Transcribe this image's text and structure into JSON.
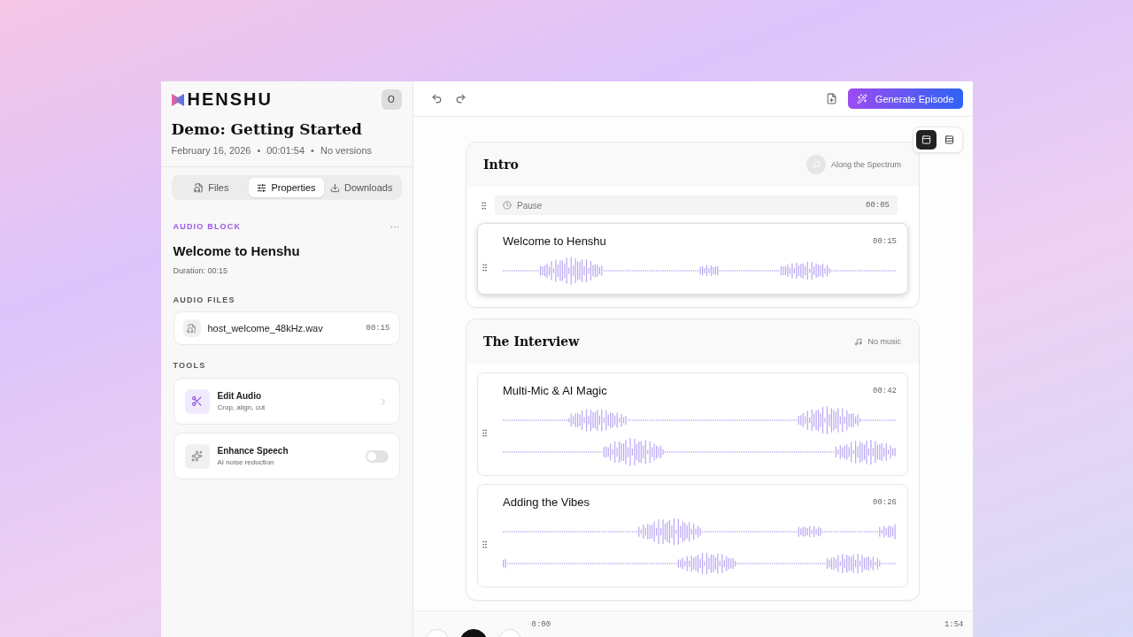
{
  "brand": {
    "name": "HENSHU",
    "avatar": "O"
  },
  "project": {
    "title": "Demo: Getting Started",
    "meta": [
      "February 16, 2026",
      "•",
      "00:01:54",
      "•",
      "No versions"
    ]
  },
  "tabs": [
    {
      "label": "Files",
      "selected": false
    },
    {
      "label": "Properties",
      "selected": true
    },
    {
      "label": "Downloads",
      "selected": false
    }
  ],
  "block": {
    "kicker": "AUDIO BLOCK",
    "menu": "···",
    "title": "Welcome to Henshu",
    "duration": "Duration: 00:15"
  },
  "audio_files": {
    "heading": "AUDIO FILES",
    "files": [
      {
        "name": "host_welcome_48kHz.wav",
        "time": "00:15"
      }
    ]
  },
  "tools": {
    "heading": "TOOLS",
    "items": [
      {
        "kind": "link",
        "title": "Edit Audio",
        "subtitle": "Crop, align, cut"
      },
      {
        "kind": "toggle",
        "title": "Enhance Speech",
        "subtitle": "AI noise reduction",
        "on": false
      }
    ]
  },
  "toolbar": {
    "generate": "Generate Episode"
  },
  "view_modes": [
    {
      "selected": true
    },
    {
      "selected": false
    }
  ],
  "sections": [
    {
      "title": "Intro",
      "music": {
        "kind": "track",
        "label": "Along the Spectrum"
      },
      "blocks": [
        {
          "kind": "pause",
          "title": "Pause",
          "time": "00:05",
          "selected": false
        },
        {
          "kind": "audio",
          "title": "Welcome to Henshu",
          "time": "00:15",
          "selected": true,
          "tracks": [
            {
              "kind": "waveform"
            }
          ]
        }
      ]
    },
    {
      "title": "The Interview",
      "music": {
        "kind": "none",
        "label": "No music"
      },
      "blocks": [
        {
          "kind": "audio",
          "title": "Multi-Mic & AI Magic",
          "time": "00:42",
          "selected": false,
          "tracks": [
            {
              "kind": "waveform"
            },
            {
              "kind": "waveform"
            }
          ]
        },
        {
          "kind": "audio",
          "title": "Adding the Vibes",
          "time": "00:26",
          "selected": false,
          "tracks": [
            {
              "kind": "waveform"
            },
            {
              "kind": "waveform"
            }
          ]
        }
      ]
    }
  ],
  "player": {
    "current": "0:00",
    "total": "1:54"
  }
}
